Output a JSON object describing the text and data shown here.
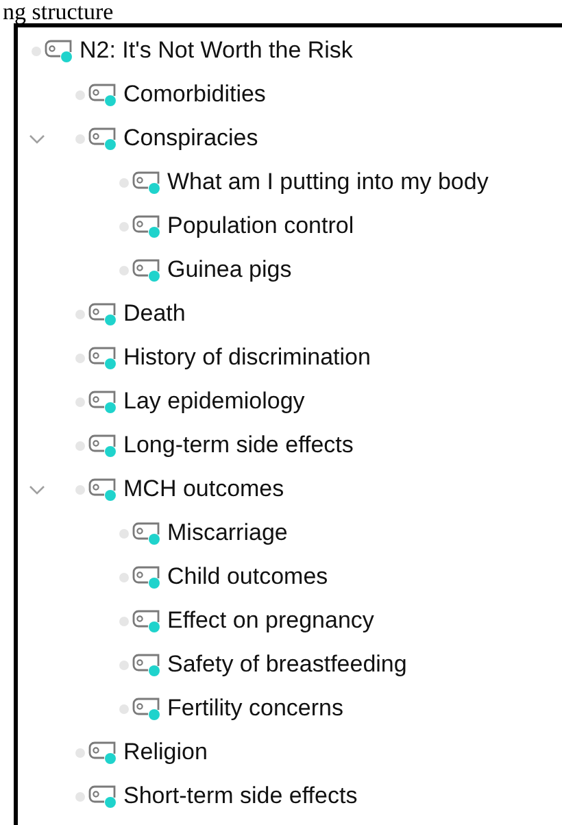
{
  "heading": "ng structure",
  "tree": [
    {
      "label": "N2: It's Not Worth the Risk",
      "children": [
        {
          "label": "Comorbidities"
        },
        {
          "label": "Conspiracies",
          "expanded": true,
          "children": [
            {
              "label": "What am I putting into my body"
            },
            {
              "label": "Population control"
            },
            {
              "label": "Guinea pigs"
            }
          ]
        },
        {
          "label": "Death"
        },
        {
          "label": "History of discrimination"
        },
        {
          "label": "Lay epidemiology"
        },
        {
          "label": "Long-term side effects"
        },
        {
          "label": "MCH outcomes",
          "expanded": true,
          "children": [
            {
              "label": "Miscarriage"
            },
            {
              "label": "Child outcomes"
            },
            {
              "label": "Effect on pregnancy"
            },
            {
              "label": "Safety of breastfeeding"
            },
            {
              "label": "Fertility concerns"
            }
          ]
        },
        {
          "label": "Religion"
        },
        {
          "label": "Short-term side effects"
        }
      ]
    }
  ]
}
